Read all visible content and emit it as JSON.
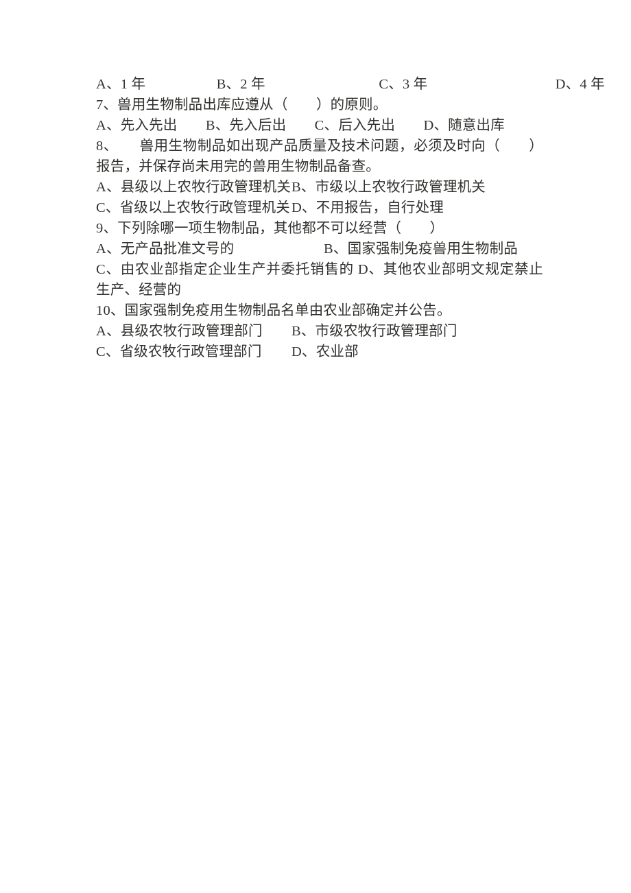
{
  "document": {
    "language": "zh-CN",
    "page_background": "#ffffff",
    "text_color": "#31312f",
    "body": {
      "q6_options_line": "A、1 年　　　　　B、2 年　　　　　　　　C、3 年　　　　　　　　　D、4 年",
      "q7": {
        "stem": "7、兽用生物制品出库应遵从（　　）的原则。",
        "options_line": "A、先入先出　　B、先入后出　　C、后入先出　　D、随意出库"
      },
      "q8": {
        "stem": "8、　　兽用生物制品如出现产品质量及技术问题，必须及时向（　　）报告，并保存尚未用完的兽用生物制品备查。",
        "option_a": "A、县级以上农牧行政管理机关",
        "option_b": "B、市级以上农牧行政管理机关",
        "option_c": "C、省级以上农牧行政管理机关",
        "option_d": "D、不用报告，自行处理"
      },
      "q9": {
        "stem": "9、下列除哪一项生物制品，其他都不可以经营（　　）",
        "option_a": "A、无产品批准文号的",
        "option_b": "B、国家强制免疫兽用生物制品",
        "options_cd_wrapped": "C、由农业部指定企业生产并委托销售的 D、其他农业部明文规定禁止生产、经营的"
      },
      "q10": {
        "stem": "10、国家强制免疫用生物制品名单由农业部确定并公告。",
        "option_a": "A、县级农牧行政管理部门",
        "option_b": "B、市级农牧行政管理部门",
        "option_c": "C、省级农牧行政管理部门",
        "option_d": "D、农业部"
      }
    }
  }
}
